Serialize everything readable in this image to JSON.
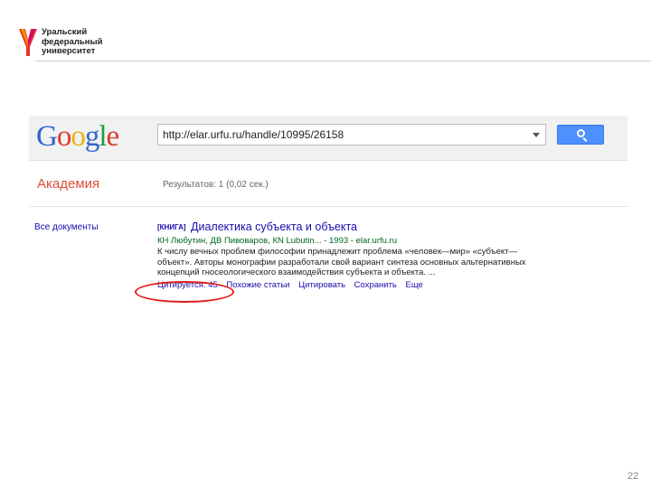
{
  "header": {
    "university_lines": [
      "Уральский",
      "федеральный",
      "университет"
    ]
  },
  "google": {
    "logo_letters": [
      "G",
      "o",
      "o",
      "g",
      "l",
      "e"
    ],
    "search_value": "http://elar.urfu.ru/handle/10995/26158",
    "academy_label": "Академия",
    "results_count": "Результатов: 1 (0,02 сек.)",
    "all_docs_label": "Все документы"
  },
  "result": {
    "tag": "[КНИГА]",
    "title": "Диалектика субъекта и объекта",
    "meta": "КН Любутин, ДВ Пивоваров, КN Lubutin... - 1993 - elar.urfu.ru",
    "snippet": "К числу вечных проблем философии принадлежит проблема «человек—мир» «субъект—объект». Авторы монографии разработали свой вариант синтеза основных альтернативных концепций гносеологического взаимодействия субъекта и объекта. ...",
    "cited_by": "Цитируется: 45",
    "related": "Похожие статьи",
    "cite": "Цитировать",
    "save": "Сохранить",
    "more": "Еще"
  },
  "page_number": "22",
  "colors": {
    "accent_red": "#e11c1c",
    "link_blue": "#1a0dab",
    "url_green": "#006621",
    "button_blue": "#4d90fe"
  }
}
